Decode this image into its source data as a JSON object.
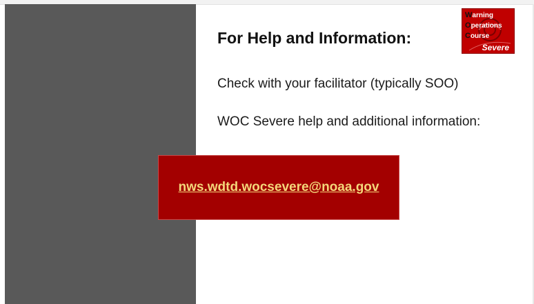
{
  "slide": {
    "title": "For Help and Information:",
    "line_facilitator": "Check with your facilitator (typically SOO)",
    "line_help": "WOC Severe help and additional information:",
    "email": "nws.wdtd.wocsevere@noaa.gov"
  },
  "logo": {
    "line1_initial": "W",
    "line1_rest": "arning",
    "line2_initial": "O",
    "line2_rest": "perations",
    "line3_initial": "C",
    "line3_rest": "ourse",
    "severe": "Severe"
  },
  "colors": {
    "left_bar": "#595959",
    "email_box": "#a30000",
    "email_text": "#f4d77a",
    "logo_bg": "#c00000"
  }
}
